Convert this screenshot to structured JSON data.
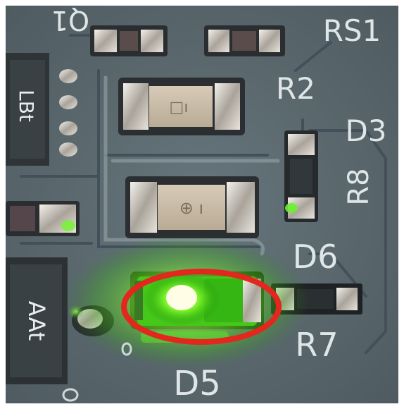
{
  "photo": {
    "silkscreen": {
      "q1": "Q1",
      "rs1": "RS1",
      "r2": "R2",
      "d3": "D3",
      "r8": "R8",
      "d6": "D6",
      "r7": "R7",
      "d5": "D5",
      "lbt": "LBt",
      "aat": "AAt"
    },
    "highlight": {
      "color": "#e3261e",
      "target": "D5"
    },
    "colors": {
      "board": "#5c6a70",
      "trace": "#4e5b62",
      "led_glow": "#7dff2a",
      "led_core": "#fff7c2",
      "chip": "#2f3437"
    }
  }
}
